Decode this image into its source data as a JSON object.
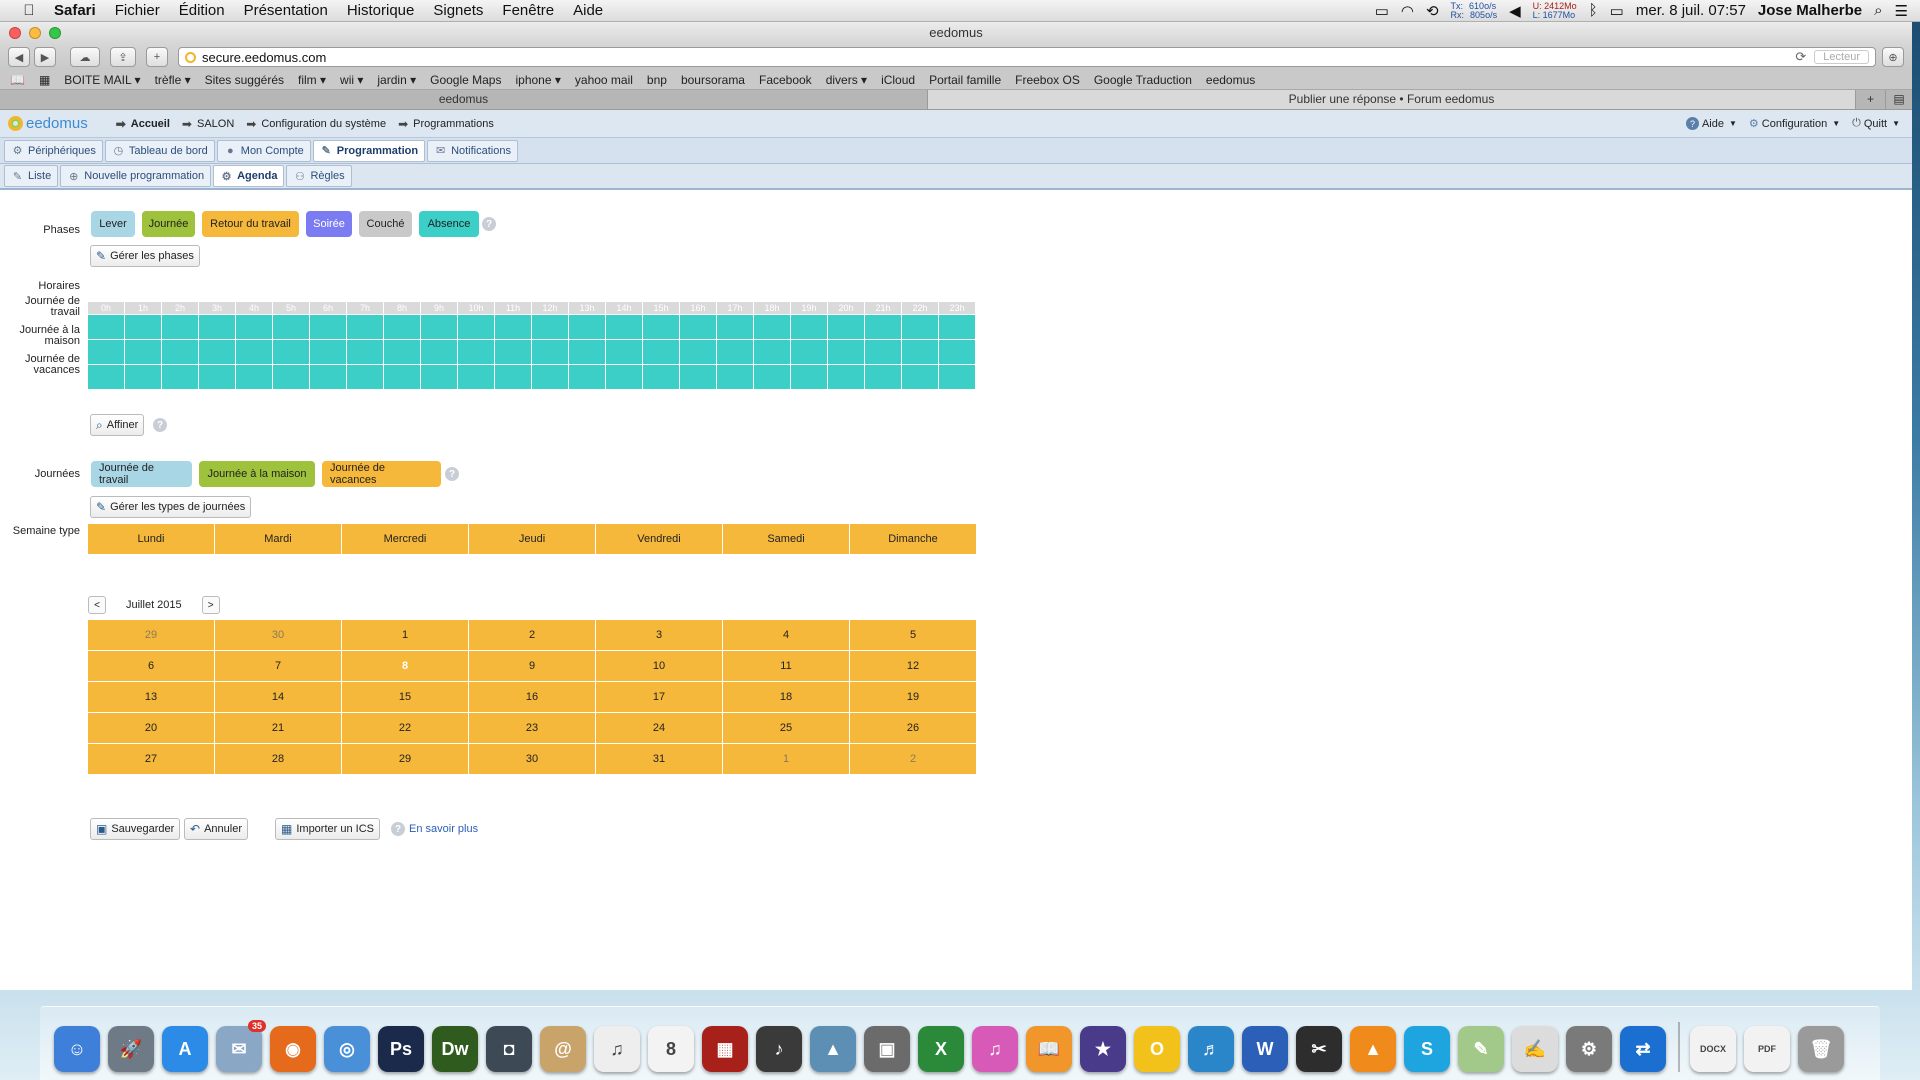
{
  "menubar": {
    "app_name": "Safari",
    "items": [
      "Fichier",
      "Édition",
      "Présentation",
      "Historique",
      "Signets",
      "Fenêtre",
      "Aide"
    ],
    "net_tx_label": "Tx:",
    "net_tx": "610o/s",
    "net_rx_label": "Rx:",
    "net_rx": "805o/s",
    "mem_u": "U: 2412Mo",
    "mem_l": "L: 1677Mo",
    "clock": "mer. 8 juil.  07:57",
    "user": "Jose Malherbe"
  },
  "window": {
    "title": "eedomus",
    "url": "secure.eedomus.com",
    "reader_label": "Lecteur",
    "bookmarks": [
      "BOITE MAIL ▾",
      "trèfle ▾",
      "Sites suggérés",
      "film ▾",
      "wii ▾",
      "jardin ▾",
      "Google Maps",
      "iphone ▾",
      "yahoo mail",
      "bnp",
      "boursorama",
      "Facebook",
      "divers ▾",
      "iCloud",
      "Portail famille",
      "Freebox OS",
      "Google Traduction",
      "eedomus"
    ],
    "tabs": [
      "eedomus",
      "Publier une réponse • Forum eedomus"
    ]
  },
  "header": {
    "logo": "eedomus",
    "breadcrumbs": [
      "Accueil",
      "SALON",
      "Configuration du système",
      "Programmations"
    ],
    "aide": "Aide",
    "configuration": "Configuration",
    "quit": "Quitt"
  },
  "nav1": [
    "Périphériques",
    "Tableau de bord",
    "Mon Compte",
    "Programmation",
    "Notifications"
  ],
  "nav2": [
    "Liste",
    "Nouvelle programmation",
    "Agenda",
    "Règles"
  ],
  "phases": {
    "label": "Phases",
    "items": [
      {
        "label": "Lever",
        "color": "#a9d6e5"
      },
      {
        "label": "Journée",
        "color": "#9ec23b"
      },
      {
        "label": "Retour du travail",
        "color": "#f6b83a"
      },
      {
        "label": "Soirée",
        "color": "#7b7bf2"
      },
      {
        "label": "Couché",
        "color": "#c9c9c9"
      },
      {
        "label": "Absence",
        "color": "#3ccfc8"
      }
    ],
    "manage_button": "Gérer les phases"
  },
  "schedule": {
    "label": "Horaires",
    "hours": [
      "0h",
      "1h",
      "2h",
      "3h",
      "4h",
      "5h",
      "6h",
      "7h",
      "8h",
      "9h",
      "10h",
      "11h",
      "12h",
      "13h",
      "14h",
      "15h",
      "16h",
      "17h",
      "18h",
      "19h",
      "20h",
      "21h",
      "22h",
      "23h"
    ],
    "rows": [
      "Journée de travail",
      "Journée à la maison",
      "Journée de vacances"
    ],
    "refine_button": "Affiner"
  },
  "journees": {
    "label": "Journées",
    "items": [
      {
        "label": "Journée de travail",
        "color": "#a9d6e5"
      },
      {
        "label": "Journée à la maison",
        "color": "#9ec23b"
      },
      {
        "label": "Journée de vacances",
        "color": "#f6b83a"
      }
    ],
    "manage_button": "Gérer les types de journées"
  },
  "week_type": {
    "label": "Semaine type",
    "days": [
      "Lundi",
      "Mardi",
      "Mercredi",
      "Jeudi",
      "Vendredi",
      "Samedi",
      "Dimanche"
    ]
  },
  "calendar": {
    "month_label": "Juillet 2015",
    "prev": "<",
    "next": ">",
    "weeks": [
      [
        "29",
        "30",
        "1",
        "2",
        "3",
        "4",
        "5"
      ],
      [
        "6",
        "7",
        "8",
        "9",
        "10",
        "11",
        "12"
      ],
      [
        "13",
        "14",
        "15",
        "16",
        "17",
        "18",
        "19"
      ],
      [
        "20",
        "21",
        "22",
        "23",
        "24",
        "25",
        "26"
      ],
      [
        "27",
        "28",
        "29",
        "30",
        "31",
        "1",
        "2"
      ]
    ],
    "today": "8"
  },
  "footer": {
    "save": "Sauvegarder",
    "cancel": "Annuler",
    "import": "Importer un ICS",
    "learn_more": "En savoir plus"
  },
  "dock": [
    {
      "name": "finder-icon",
      "color": "#3d7fd9",
      "glyph": "☺"
    },
    {
      "name": "launchpad-icon",
      "color": "#6e7a86",
      "glyph": "🚀"
    },
    {
      "name": "app-store-icon",
      "color": "#2b8be6",
      "glyph": "A"
    },
    {
      "name": "mail-icon",
      "color": "#8aa7c6",
      "glyph": "✉",
      "badge": "35"
    },
    {
      "name": "firefox-icon",
      "color": "#e66a1b",
      "glyph": "◉"
    },
    {
      "name": "safari-icon",
      "color": "#4a90d9",
      "glyph": "◎"
    },
    {
      "name": "photoshop-icon",
      "color": "#1b2a4a",
      "glyph": "Ps"
    },
    {
      "name": "dreamweaver-icon",
      "color": "#2f5c1e",
      "glyph": "Dw"
    },
    {
      "name": "facetime-icon",
      "color": "#3d4a55",
      "glyph": "◘"
    },
    {
      "name": "contacts-icon",
      "color": "#c8a36a",
      "glyph": "@"
    },
    {
      "name": "itunes-alt-icon",
      "color": "#eeeeee",
      "glyph": "♫"
    },
    {
      "name": "calendar-icon",
      "color": "#f3f3f3",
      "glyph": "8"
    },
    {
      "name": "photo-booth-icon",
      "color": "#a8201a",
      "glyph": "▦"
    },
    {
      "name": "garageband-icon",
      "color": "#3a3a3a",
      "glyph": "♪"
    },
    {
      "name": "iphoto-icon",
      "color": "#5d8fb5",
      "glyph": "▲"
    },
    {
      "name": "photo-icon",
      "color": "#6b6b6b",
      "glyph": "▣"
    },
    {
      "name": "excel-icon",
      "color": "#2a8a3a",
      "glyph": "X"
    },
    {
      "name": "itunes-icon",
      "color": "#d85ab8",
      "glyph": "♫"
    },
    {
      "name": "ibooks-icon",
      "color": "#f0962a",
      "glyph": "📖"
    },
    {
      "name": "imovie-icon",
      "color": "#4a3b8a",
      "glyph": "★"
    },
    {
      "name": "opera-icon",
      "color": "#f2c21b",
      "glyph": "O"
    },
    {
      "name": "music-icon",
      "color": "#2a86c8",
      "glyph": "♬"
    },
    {
      "name": "word-icon",
      "color": "#2b5fb8",
      "glyph": "W"
    },
    {
      "name": "final-cut-icon",
      "color": "#2d2d2d",
      "glyph": "✂"
    },
    {
      "name": "vlc-icon",
      "color": "#f08a1b",
      "glyph": "▲"
    },
    {
      "name": "skype-icon",
      "color": "#1ea5e0",
      "glyph": "S"
    },
    {
      "name": "preview-icon",
      "color": "#a3c98a",
      "glyph": "✎"
    },
    {
      "name": "textedit-icon",
      "color": "#dcdcdc",
      "glyph": "✍"
    },
    {
      "name": "system-preferences-icon",
      "color": "#7a7a7a",
      "glyph": "⚙"
    },
    {
      "name": "teamviewer-icon",
      "color": "#1a6fd0",
      "glyph": "⇄"
    },
    {
      "name": "docx-icon",
      "color": "#f2f2f2",
      "glyph": "DOCX"
    },
    {
      "name": "pdf-icon",
      "color": "#f2f2f2",
      "glyph": "PDF"
    },
    {
      "name": "trash-icon",
      "color": "#9a9a9a",
      "glyph": "🗑"
    }
  ]
}
